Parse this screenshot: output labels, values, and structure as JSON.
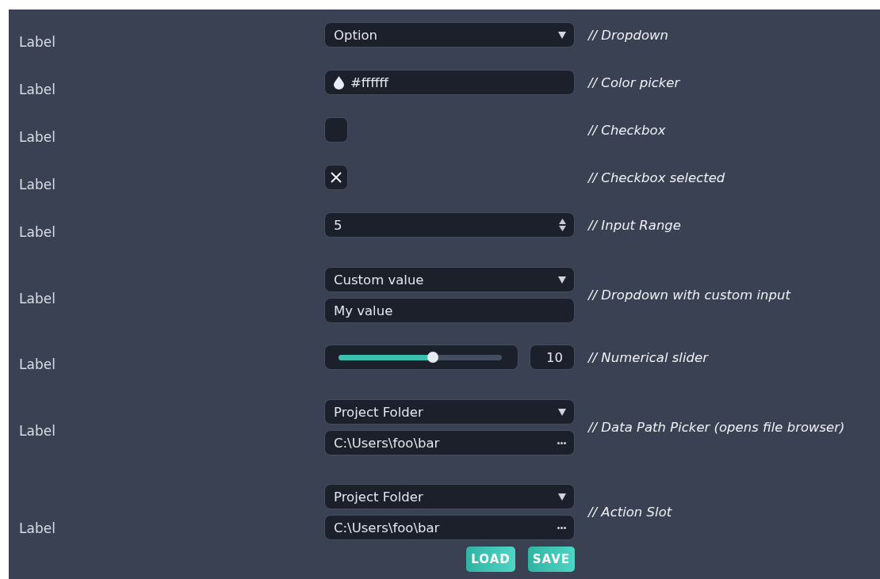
{
  "rows": [
    {
      "label": "Label",
      "comment": "// Dropdown",
      "controls": [
        {
          "kind": "dropdown",
          "value": "Option"
        }
      ]
    },
    {
      "label": "Label",
      "comment": "// Color picker",
      "controls": [
        {
          "kind": "color",
          "value": "#ffffff"
        }
      ]
    },
    {
      "label": "Label",
      "comment": "// Checkbox",
      "controls": [
        {
          "kind": "checkbox",
          "checked": false
        }
      ]
    },
    {
      "label": "Label",
      "comment": "// Checkbox selected",
      "controls": [
        {
          "kind": "checkbox",
          "checked": true
        }
      ]
    },
    {
      "label": "Label",
      "comment": "// Input Range",
      "controls": [
        {
          "kind": "range",
          "value": "5"
        }
      ]
    },
    {
      "label": "Label",
      "comment": "// Dropdown with custom input",
      "controls": [
        {
          "kind": "dropdown",
          "value": "Custom value"
        },
        {
          "kind": "text",
          "value": "My value"
        }
      ]
    },
    {
      "label": "Label",
      "comment": "// Numerical slider",
      "controls": [
        {
          "kind": "slider",
          "level": 0.58,
          "value": "10"
        }
      ]
    },
    {
      "label": "Label",
      "comment": "// Data Path Picker (opens file browser)",
      "controls": [
        {
          "kind": "dropdown",
          "value": "Project Folder"
        },
        {
          "kind": "path",
          "value": "C:\\Users\\foo\\bar"
        }
      ]
    },
    {
      "label": "Label",
      "comment": "// Action Slot",
      "controls": [
        {
          "kind": "dropdown",
          "value": "Project Folder"
        },
        {
          "kind": "path",
          "value": "C:\\Users\\foo\\bar"
        }
      ],
      "buttons": [
        "LOAD",
        "SAVE"
      ]
    }
  ]
}
